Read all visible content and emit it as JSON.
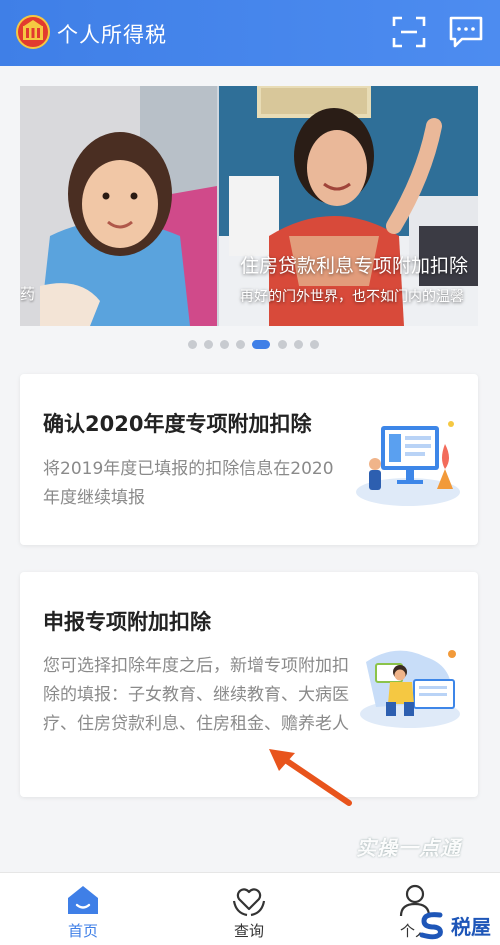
{
  "header": {
    "title": "个人所得税"
  },
  "carousel": {
    "left_caption": "药",
    "slide_title": "住房贷款利息专项附加扣除",
    "slide_subtitle": "再好的门外世界，也不如门内的温馨",
    "dot_count": 8,
    "active_index": 4
  },
  "cards": [
    {
      "title": "确认2020年度专项附加扣除",
      "description": "将2019年度已填报的扣除信息在2020年度继续填报"
    },
    {
      "title": "申报专项附加扣除",
      "description": "您可选择扣除年度之后，新增专项附加扣除的填报：子女教育、继续教育、大病医疗、住房贷款利息、住房租金、赡养老人"
    }
  ],
  "watermark": "实操一点通",
  "nav": {
    "home": "首页",
    "query": "查询",
    "personal": "个人"
  },
  "logo": "税屋",
  "colors": {
    "accent": "#3f7fe7",
    "arrow": "#e8541c"
  }
}
